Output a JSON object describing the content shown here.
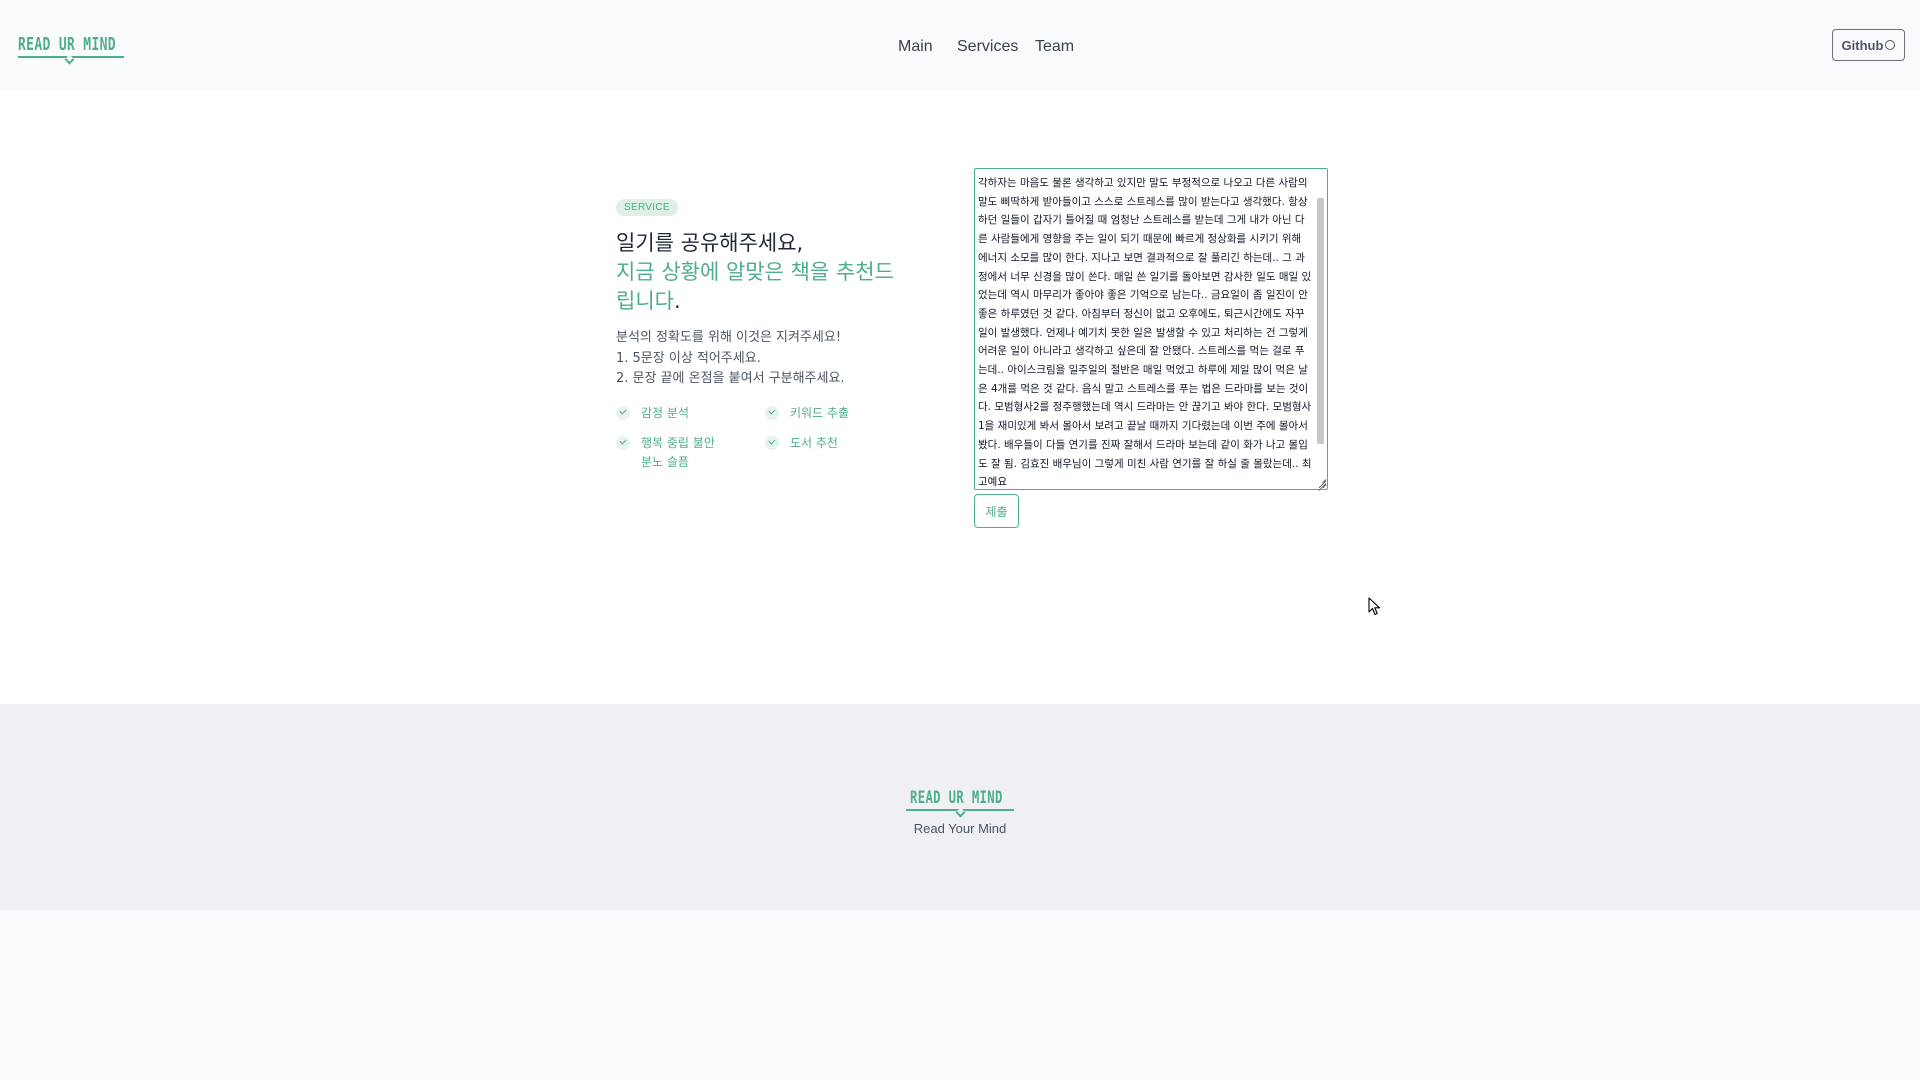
{
  "header": {
    "logo_text": "READ UR MIND",
    "nav": [
      "Main",
      "Services",
      "Team"
    ],
    "github_label": "Github"
  },
  "service": {
    "badge": "SERVICE",
    "headline_line1": "일기를 공유해주세요,",
    "headline_green_1": "지금 상황에 알맞은 책을 추천드",
    "headline_green_2": "립니다",
    "headline_end": ".",
    "instructions": [
      "분석의 정확도를 위해 이것은 지켜주세요!",
      "1. 5문장 이상 적어주세요.",
      "2. 문장 끝에 온점을 붙여서 구분해주세요."
    ],
    "features": [
      {
        "line1": "감정 분석",
        "line2": ""
      },
      {
        "line1": "키워드 추출",
        "line2": ""
      },
      {
        "line1": "행복 중립 불안",
        "line2": "분노 슬픔"
      },
      {
        "line1": "도서 추천",
        "line2": ""
      }
    ]
  },
  "diary": {
    "text": "각하자는 마음도 물론 생각하고 있지만 말도 부정적으로 나오고 다른 사람의 말도 삐딱하게 받아들이고 스스로 스트레스를 많이 받는다고 생각했다. 항상 하던 일들이 갑자기 틀어질 때 엄청난 스트레스를 받는데 그게 내가 아닌 다른 사람들에게 영향을 주는 일이 되기 때문에 빠르게 정상화를 시키기 위해 에너지 소모를 많이 한다. 지나고 보면 결과적으로 잘 풀리긴 하는데.. 그 과정에서 너무 신경을 많이 쓴다. 매일 쓴 일기를 돌아보면 감사한 일도 매일 있었는데 역시 마무리가 좋아야 좋은 기억으로 남는다.. 금요일이 좀 일진이 안 좋은 하루였던 것 같다. 아침부터 정신이 없고 오후에도, 퇴근시간에도 자꾸 일이 발생했다. 언제나 예기치 못한 일은 발생할 수 있고 처리하는 건 그렇게 어려운 일이 아니라고 생각하고 싶은데 잘 안됐다. 스트레스를 먹는 걸로 푸는데.. 아이스크림을 일주일의 절반은 매일 먹었고 하루에 제일 많이 먹은 날은 4개를 먹은 것 같다. 음식 말고 스트레스를 푸는 법은 드라마를 보는 것이다. 모범형사2를 정주행했는데 역시 드라마는 안 끊기고 봐야 한다. 모범형사1을 재미있게 봐서 몰아서 보려고 끝날 때까지 기다렸는데 이번 주에 몰아서 봤다. 배우들이 다들 연기를 진짜 잘해서 드라마 보는데 같이 화가 나고 몰입도 잘 됨. 김효진 배우님이 그렇게 미친 사람 연기를 잘 하실 줄 몰랐는데.. 최고예요",
    "submit_label": "제출"
  },
  "footer": {
    "logo_text": "READ UR MIND",
    "tagline": "Read Your Mind"
  },
  "colors": {
    "accent": "#4fae89",
    "badge_bg": "#dcf0e6",
    "footer_bg": "#eef0f3"
  }
}
